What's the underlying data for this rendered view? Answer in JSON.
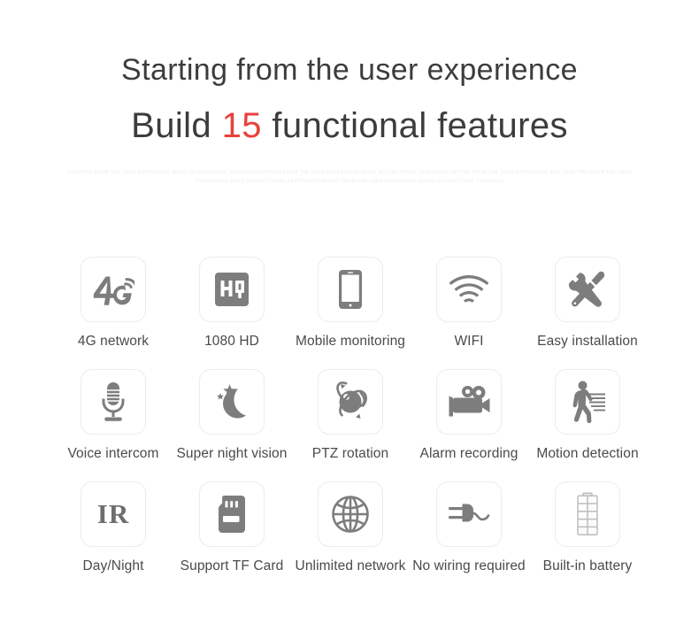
{
  "hero": {
    "line1": "Starting from the user experience",
    "line2_prefix": "Build ",
    "line2_number": "15",
    "line2_suffix": " functional features",
    "accent_color": "#e8413c",
    "text_color": "#3c3c3c"
  },
  "microtext": {
    "color": "#ededed",
    "content": "STARTING FROM THE USER EXPERIENCE BUILD 18 FUNCTIONAL FEATURESSTARTING FROM THE USER EXPERIENCE BUILD 18 FUNCTIONAL FEATURESSTARTING FROM THE USER EXPERIENCE BUIL STARTING FROM THE USER EXPERIENCE BUILD 18 FUNCTIONAL FEATURESSTARTING FROM THE USER EXPERIENCE BUILD 18 FUNCTIONAL FEATURES"
  },
  "features": {
    "icon_color": "#7d7d7d",
    "tile_border_color": "#ececec",
    "rows": [
      [
        {
          "label": "4G network",
          "icon": "4g-signal-icon"
        },
        {
          "label": "1080 HD",
          "icon": "hq-badge-icon"
        },
        {
          "label": "Mobile monitoring",
          "icon": "smartphone-icon"
        },
        {
          "label": "WIFI",
          "icon": "wifi-icon"
        },
        {
          "label": "Easy installation",
          "icon": "wrench-screwdriver-icon"
        }
      ],
      [
        {
          "label": "Voice intercom",
          "icon": "microphone-icon"
        },
        {
          "label": "Super night vision",
          "icon": "moon-stars-icon"
        },
        {
          "label": "PTZ rotation",
          "icon": "orbit-sphere-icon"
        },
        {
          "label": "Alarm recording",
          "icon": "movie-camera-icon"
        },
        {
          "label": "Motion detection",
          "icon": "walking-person-icon"
        }
      ],
      [
        {
          "label": "Day/Night",
          "icon": "ir-text-icon"
        },
        {
          "label": "Support TF Card",
          "icon": "sd-card-icon"
        },
        {
          "label": "Unlimited network",
          "icon": "globe-icon"
        },
        {
          "label": "No wiring required",
          "icon": "power-plug-icon"
        },
        {
          "label": "Built-in battery",
          "icon": "battery-icon"
        }
      ]
    ]
  }
}
